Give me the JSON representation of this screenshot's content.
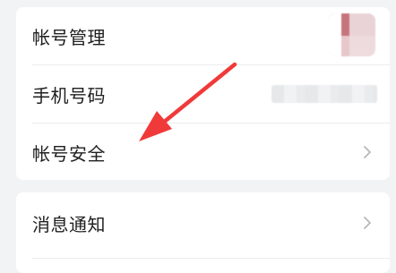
{
  "settings": {
    "group1": {
      "items": [
        {
          "label": "帐号管理"
        },
        {
          "label": "手机号码"
        },
        {
          "label": "帐号安全"
        }
      ]
    },
    "group2": {
      "items": [
        {
          "label": "消息通知"
        }
      ]
    }
  },
  "icons": {
    "chevron": "chevron-right-icon",
    "avatar": "avatar",
    "annotation": "red-arrow"
  },
  "colors": {
    "background": "#f2f3f5",
    "card": "#ffffff",
    "text": "#1f1f1f",
    "chevron": "#b8b8b8",
    "annotation_arrow": "#f03a3a"
  }
}
